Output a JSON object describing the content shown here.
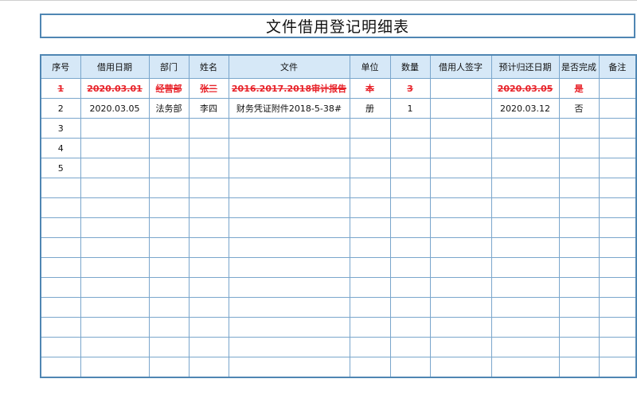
{
  "title": "文件借用登记明细表",
  "colors": {
    "border": "#4f86b3",
    "header_bg": "#d6e8f7",
    "struck_text": "#e8232a"
  },
  "headers": [
    "序号",
    "借用日期",
    "部门",
    "姓名",
    "文件",
    "单位",
    "数量",
    "借用人签字",
    "预计归还日期",
    "是否完成",
    "备注"
  ],
  "rows": [
    {
      "no": "1",
      "date": "2020.03.01",
      "dept": "经营部",
      "name": "张三",
      "file": "2016.2017.2018审计报告",
      "unit": "本",
      "qty": "3",
      "sign": "",
      "return_date": "2020.03.05",
      "done": "是",
      "remark": ""
    },
    {
      "no": "2",
      "date": "2020.03.05",
      "dept": "法务部",
      "name": "李四",
      "file": "财务凭证附件2018-5-38#",
      "unit": "册",
      "qty": "1",
      "sign": "",
      "return_date": "2020.03.12",
      "done": "否",
      "remark": ""
    },
    {
      "no": "3",
      "date": "",
      "dept": "",
      "name": "",
      "file": "",
      "unit": "",
      "qty": "",
      "sign": "",
      "return_date": "",
      "done": "",
      "remark": ""
    },
    {
      "no": "4",
      "date": "",
      "dept": "",
      "name": "",
      "file": "",
      "unit": "",
      "qty": "",
      "sign": "",
      "return_date": "",
      "done": "",
      "remark": ""
    },
    {
      "no": "5",
      "date": "",
      "dept": "",
      "name": "",
      "file": "",
      "unit": "",
      "qty": "",
      "sign": "",
      "return_date": "",
      "done": "",
      "remark": ""
    },
    {
      "no": "",
      "date": "",
      "dept": "",
      "name": "",
      "file": "",
      "unit": "",
      "qty": "",
      "sign": "",
      "return_date": "",
      "done": "",
      "remark": ""
    },
    {
      "no": "",
      "date": "",
      "dept": "",
      "name": "",
      "file": "",
      "unit": "",
      "qty": "",
      "sign": "",
      "return_date": "",
      "done": "",
      "remark": ""
    },
    {
      "no": "",
      "date": "",
      "dept": "",
      "name": "",
      "file": "",
      "unit": "",
      "qty": "",
      "sign": "",
      "return_date": "",
      "done": "",
      "remark": ""
    },
    {
      "no": "",
      "date": "",
      "dept": "",
      "name": "",
      "file": "",
      "unit": "",
      "qty": "",
      "sign": "",
      "return_date": "",
      "done": "",
      "remark": ""
    },
    {
      "no": "",
      "date": "",
      "dept": "",
      "name": "",
      "file": "",
      "unit": "",
      "qty": "",
      "sign": "",
      "return_date": "",
      "done": "",
      "remark": ""
    },
    {
      "no": "",
      "date": "",
      "dept": "",
      "name": "",
      "file": "",
      "unit": "",
      "qty": "",
      "sign": "",
      "return_date": "",
      "done": "",
      "remark": ""
    },
    {
      "no": "",
      "date": "",
      "dept": "",
      "name": "",
      "file": "",
      "unit": "",
      "qty": "",
      "sign": "",
      "return_date": "",
      "done": "",
      "remark": ""
    },
    {
      "no": "",
      "date": "",
      "dept": "",
      "name": "",
      "file": "",
      "unit": "",
      "qty": "",
      "sign": "",
      "return_date": "",
      "done": "",
      "remark": ""
    },
    {
      "no": "",
      "date": "",
      "dept": "",
      "name": "",
      "file": "",
      "unit": "",
      "qty": "",
      "sign": "",
      "return_date": "",
      "done": "",
      "remark": ""
    },
    {
      "no": "",
      "date": "",
      "dept": "",
      "name": "",
      "file": "",
      "unit": "",
      "qty": "",
      "sign": "",
      "return_date": "",
      "done": "",
      "remark": ""
    }
  ]
}
